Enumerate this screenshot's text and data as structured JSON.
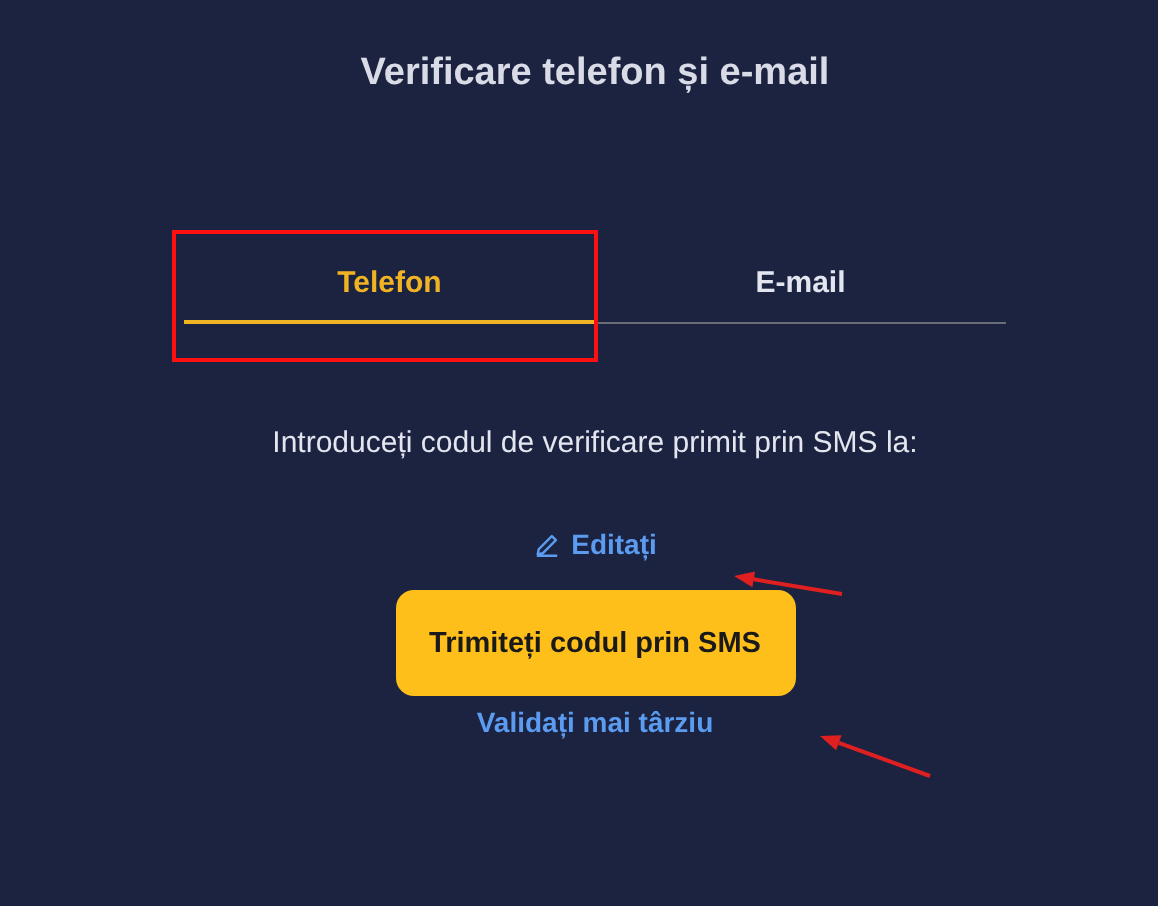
{
  "title": "Verificare telefon și e-mail",
  "tabs": [
    {
      "label": "Telefon",
      "selected": true
    },
    {
      "label": "E-mail",
      "selected": false
    }
  ],
  "instruction": "Introduceți codul de verificare primit prin SMS la:",
  "edit_link": "Editați",
  "send_button": "Trimiteți codul prin SMS",
  "later_link": "Validați mai târziu",
  "annotations": [
    {
      "kind": "box"
    },
    {
      "kind": "arrow"
    },
    {
      "kind": "arrow"
    }
  ]
}
